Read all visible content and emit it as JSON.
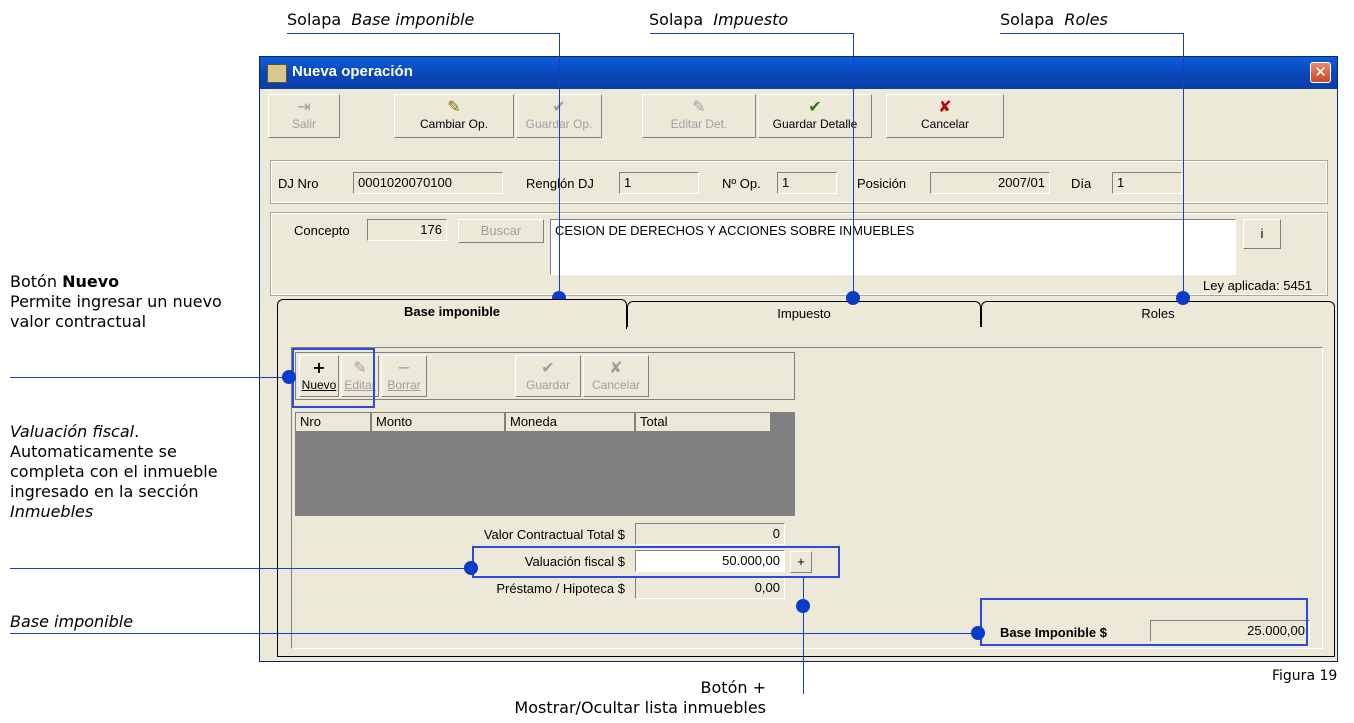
{
  "captions": {
    "tab_base": {
      "prefix": "Solapa",
      "name": "Base imponible"
    },
    "tab_impuesto": {
      "prefix": "Solapa",
      "name": "Impuesto"
    },
    "tab_roles": {
      "prefix": "Solapa",
      "name": "Roles"
    },
    "nuevo_title": "Botón",
    "nuevo_bold": "Nuevo",
    "nuevo_desc": "Permite ingresar un nuevo valor contractual",
    "valuacion_title": "Valuación fiscal",
    "valuacion_desc": ". Automaticamente se completa con el inmueble ingresado en la sección",
    "valuacion_section": "Inmuebles",
    "base_imponible": "Base imponible",
    "boton_plus_title": "Botón +",
    "boton_plus_desc": "Mostrar/Ocultar lista inmuebles",
    "figura": "Figura 19"
  },
  "window": {
    "title": "Nueva operación",
    "close": "✕"
  },
  "toolbar": {
    "salir": "Salir",
    "cambiar": "Cambiar Op.",
    "guardar_op": "Guardar Op.",
    "editar_det": "Editar Det.",
    "guardar_detalle": "Guardar Detalle",
    "cancelar": "Cancelar"
  },
  "header": {
    "dj_label": "DJ Nro",
    "dj_value": "0001020070100",
    "renglon_label": "Renglón DJ",
    "renglon_value": "1",
    "nop_label": "Nº Op.",
    "nop_value": "1",
    "posicion_label": "Posición",
    "posicion_value": "2007/01",
    "dia_label": "Día",
    "dia_value": "1"
  },
  "concepto": {
    "label": "Concepto",
    "code": "176",
    "buscar": "Buscar",
    "description": "CESION DE DERECHOS Y ACCIONES SOBRE INMUEBLES",
    "info_button": "i",
    "ley": "Ley aplicada: 5451"
  },
  "tabs": [
    "Base imponible",
    "Impuesto",
    "Roles"
  ],
  "subtoolbar": {
    "nuevo": "Nuevo",
    "editar": "Editar",
    "borrar": "Borrar",
    "guardar": "Guardar",
    "cancelar": "Cancelar"
  },
  "grid": {
    "columns": [
      "Nro",
      "Monto",
      "Moneda",
      "Total"
    ]
  },
  "values": {
    "valor_contractual_label": "Valor Contractual Total $",
    "valor_contractual": "0",
    "valuacion_label": "Valuación fiscal $",
    "valuacion": "50.000,00",
    "plus_button": "+",
    "prestamo_label": "Préstamo / Hipoteca $",
    "prestamo": "0,00",
    "base_label": "Base Imponible $",
    "base": "25.000,00"
  },
  "colors": {
    "annotation": "#1a3cc8",
    "title_bar": "#0a5fd8",
    "window_bg": "#ece9d8",
    "grid_bg": "#808080"
  }
}
